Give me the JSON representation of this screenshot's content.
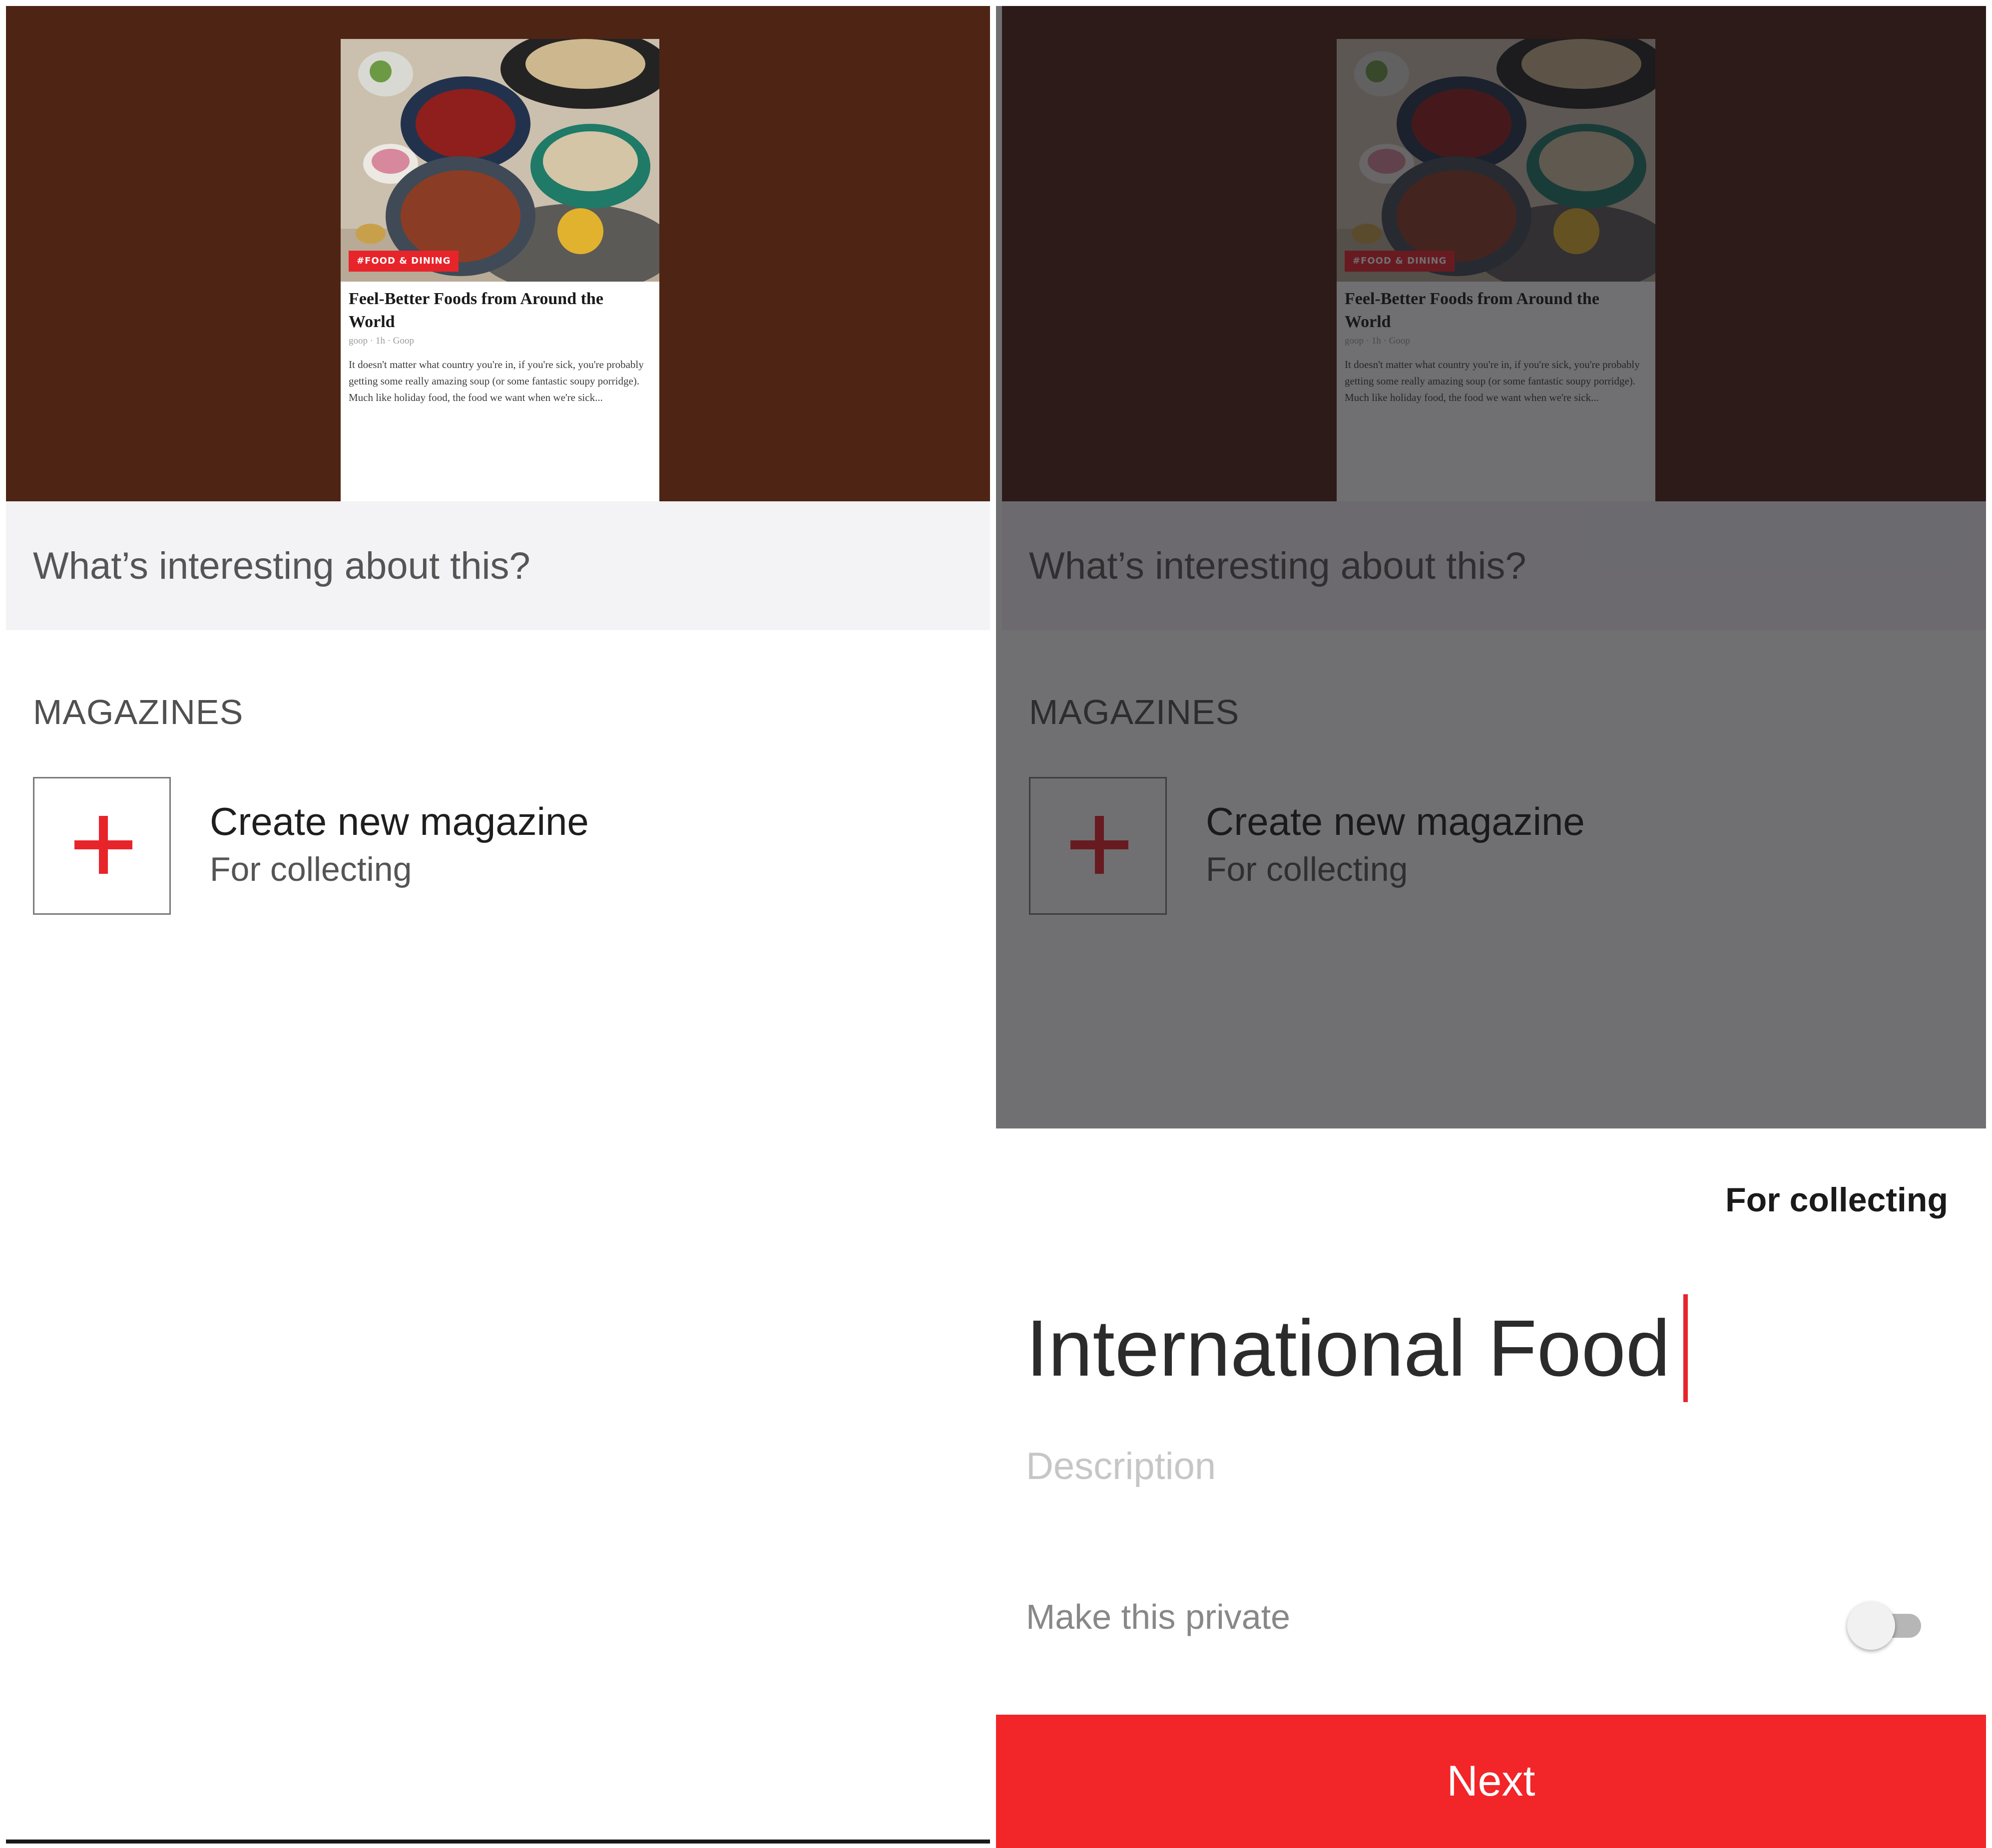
{
  "colors": {
    "accent": "#e8242b",
    "hero_background": "#4e2415",
    "next_button": "#f22529"
  },
  "article": {
    "tag": "#FOOD & DINING",
    "title": "Feel-Better Foods from Around the World",
    "meta": "goop · 1h · Goop",
    "excerpt": "It doesn't matter what country you're in, if you're sick, you're probably getting some really amazing soup (or some fantastic soupy porridge). Much like holiday food, the food we want when we're sick..."
  },
  "prompt": {
    "placeholder": "What’s interesting about this?"
  },
  "magazines": {
    "section_title": "MAGAZINES",
    "create": {
      "title": "Create new magazine",
      "subtitle": "For collecting",
      "icon": "plus-icon"
    }
  },
  "create_sheet": {
    "type_label": "For collecting",
    "name_value": "International Food",
    "description_placeholder": "Description",
    "private_label": "Make this private",
    "private_enabled": false,
    "next_label": "Next"
  }
}
